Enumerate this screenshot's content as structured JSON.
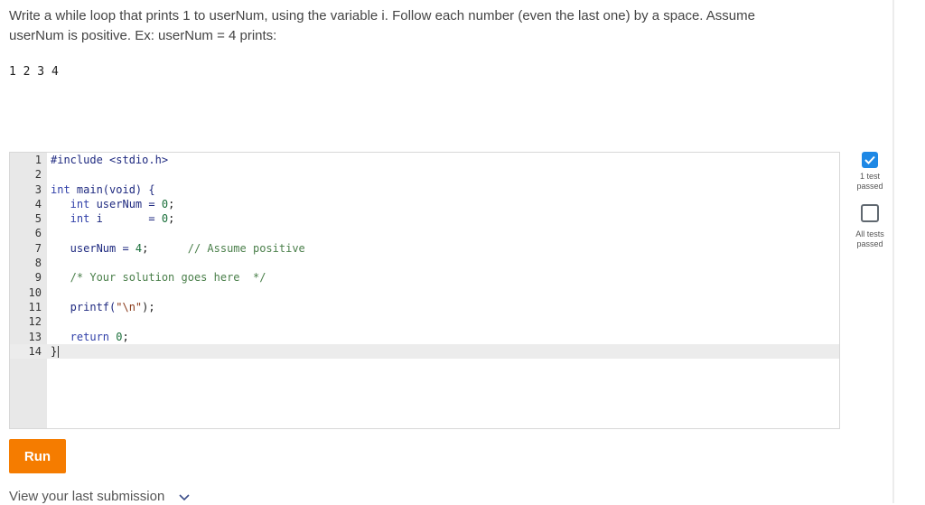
{
  "prompt": {
    "line1": "Write a while loop that prints 1 to userNum, using the variable i. Follow each number (even the last one) by a space. Assume",
    "line2": "userNum is positive. Ex: userNum = 4 prints:"
  },
  "example_output": "1 2 3 4",
  "editor": {
    "active_line": 14,
    "lines": [
      {
        "n": "1",
        "parts": [
          {
            "t": "#include <stdio.h>",
            "c": "k-pre"
          }
        ]
      },
      {
        "n": "2",
        "parts": []
      },
      {
        "n": "3",
        "parts": [
          {
            "t": "int ",
            "c": "k-kw"
          },
          {
            "t": "main(void) {",
            "c": "k-pre"
          }
        ]
      },
      {
        "n": "4",
        "parts": [
          {
            "t": "   int ",
            "c": "k-kw"
          },
          {
            "t": "userNum = ",
            "c": "k-pre"
          },
          {
            "t": "0",
            "c": "k-num"
          },
          {
            "t": ";",
            "c": "k-plain"
          }
        ]
      },
      {
        "n": "5",
        "parts": [
          {
            "t": "   int ",
            "c": "k-kw"
          },
          {
            "t": "i       = ",
            "c": "k-pre"
          },
          {
            "t": "0",
            "c": "k-num"
          },
          {
            "t": ";",
            "c": "k-plain"
          }
        ]
      },
      {
        "n": "6",
        "parts": []
      },
      {
        "n": "7",
        "parts": [
          {
            "t": "   userNum = ",
            "c": "k-pre"
          },
          {
            "t": "4",
            "c": "k-num"
          },
          {
            "t": ";      ",
            "c": "k-plain"
          },
          {
            "t": "// Assume positive",
            "c": "k-com"
          }
        ]
      },
      {
        "n": "8",
        "parts": []
      },
      {
        "n": "9",
        "parts": [
          {
            "t": "   /* Your solution goes here  */",
            "c": "k-com"
          }
        ]
      },
      {
        "n": "10",
        "parts": []
      },
      {
        "n": "11",
        "parts": [
          {
            "t": "   printf(",
            "c": "k-pre"
          },
          {
            "t": "\"\\n\"",
            "c": "k-str"
          },
          {
            "t": ");",
            "c": "k-plain"
          }
        ]
      },
      {
        "n": "12",
        "parts": []
      },
      {
        "n": "13",
        "parts": [
          {
            "t": "   return ",
            "c": "k-kw"
          },
          {
            "t": "0",
            "c": "k-num"
          },
          {
            "t": ";",
            "c": "k-plain"
          }
        ]
      },
      {
        "n": "14",
        "parts": [
          {
            "t": "}",
            "c": "k-plain"
          }
        ]
      }
    ]
  },
  "status": {
    "test1_label_a": "1 test",
    "test1_label_b": "passed",
    "test1_checked": true,
    "all_label_a": "All tests",
    "all_label_b": "passed",
    "all_checked": false,
    "check_color": "#1e88e5"
  },
  "run_button": "Run",
  "view_last_submission": "View your last submission",
  "icons": {
    "check": "check-icon",
    "chevron": "chevron-down-icon"
  },
  "colors": {
    "run_button": "#f57c00",
    "gutter": "#e8e8e8"
  }
}
